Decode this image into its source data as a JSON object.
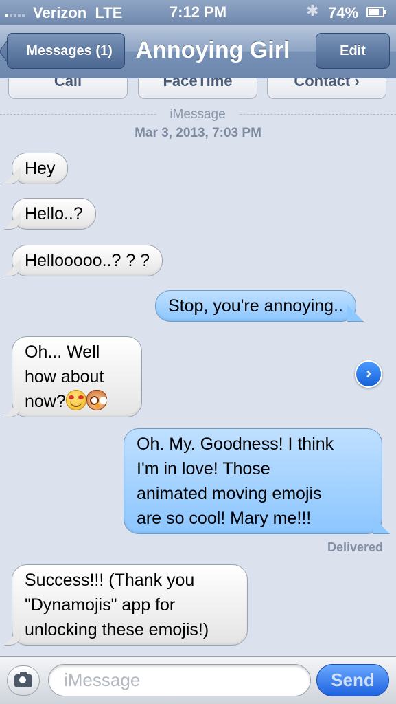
{
  "status_bar": {
    "carrier": "Verizon",
    "network": "LTE",
    "time": "7:12 PM",
    "battery_percent": "74%",
    "battery_level": 0.74
  },
  "nav": {
    "back_label": "Messages (1)",
    "title": "Annoying Girl",
    "edit_label": "Edit"
  },
  "actions": [
    "Call",
    "FaceTime",
    "Contact"
  ],
  "thread_header": {
    "service": "iMessage",
    "date": "Mar 3, 2013, 7:03 PM"
  },
  "messages": [
    {
      "direction": "incoming",
      "text": "Hey"
    },
    {
      "direction": "incoming",
      "text": "Hello..?"
    },
    {
      "direction": "incoming",
      "text": "Hellooooo..?  ?   ?"
    },
    {
      "direction": "outgoing",
      "text": "Stop, you're annoying.."
    },
    {
      "direction": "incoming",
      "lines": [
        "Oh... Well",
        "how about",
        "now?"
      ],
      "emojis": [
        "smiling-face-with-heart-eyes",
        "owl"
      ]
    },
    {
      "direction": "outgoing",
      "lines": [
        "Oh. My.  Goodness! I think",
        "I'm in love! Those",
        "animated moving emojis",
        "are so cool! Mary me!!!"
      ]
    },
    {
      "direction": "incoming",
      "lines": [
        "Success!!! (Thank you",
        "\"Dynamojis\" app for",
        "unlocking these emojis!)"
      ]
    }
  ],
  "delivery_status": "Delivered",
  "compose": {
    "placeholder": "iMessage",
    "value": "",
    "send_label": "Send"
  },
  "colors": {
    "nav_bar": "#7791b6",
    "background": "#dbe2ed",
    "incoming_bubble": "#f0f0f0",
    "outgoing_bubble": "#a6d3ff",
    "send_button": "#1f63e0"
  },
  "icons": [
    "signal-icon",
    "bluetooth-icon",
    "battery-icon",
    "detail-disclosure-icon",
    "camera-icon"
  ]
}
